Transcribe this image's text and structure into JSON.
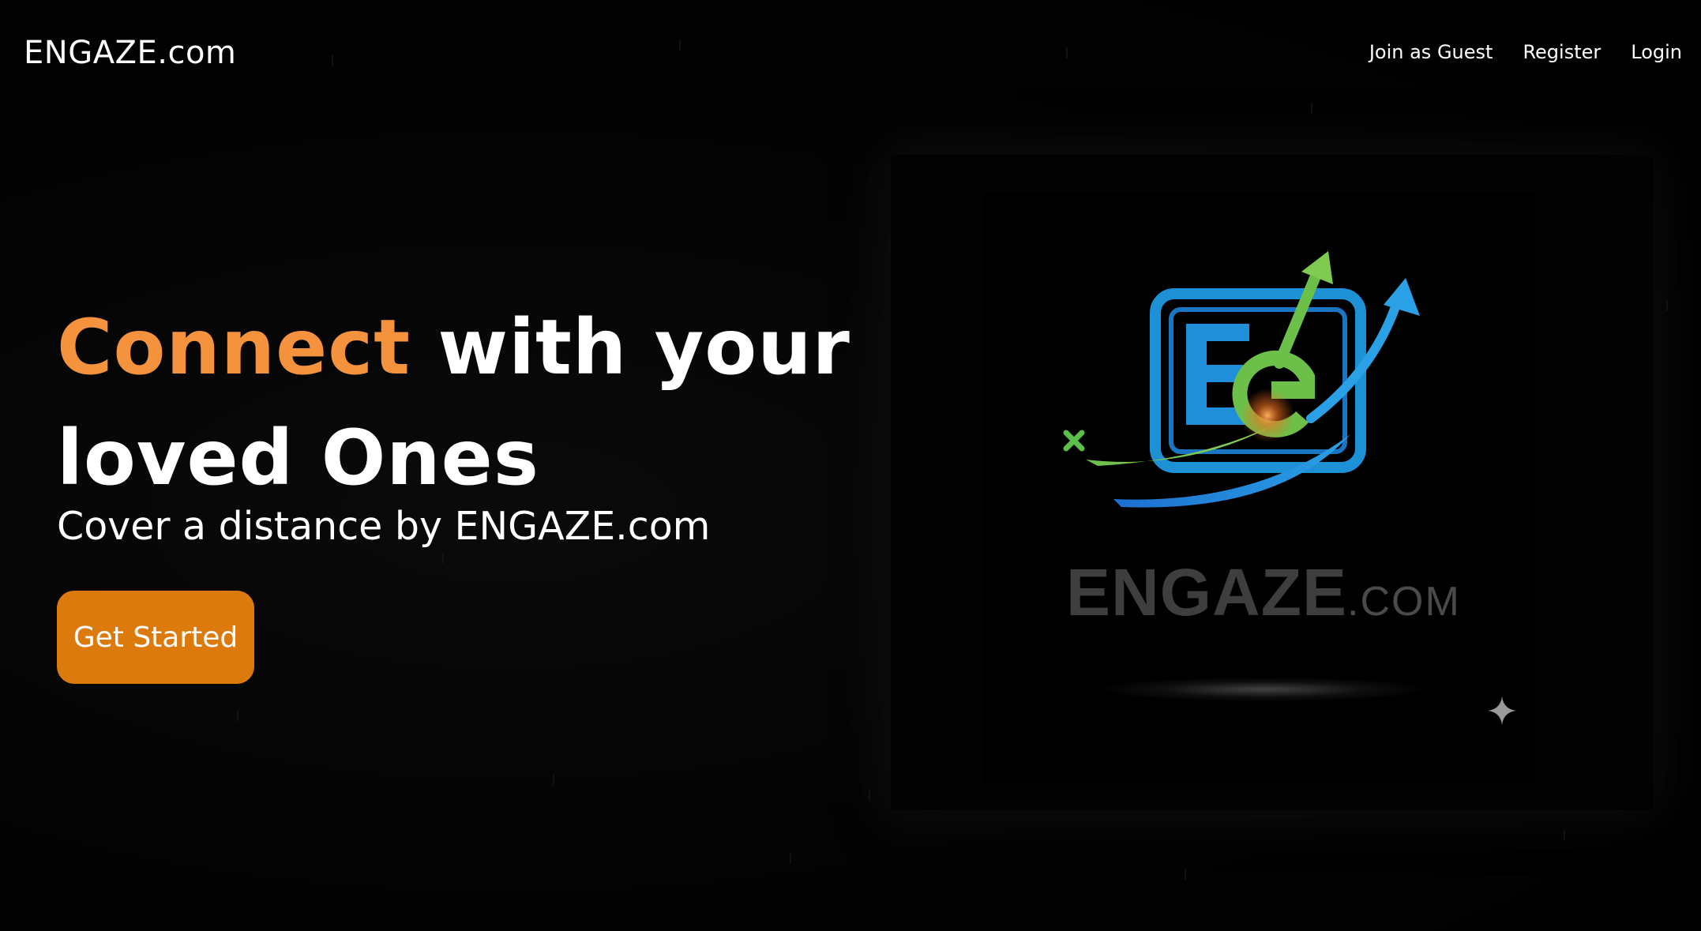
{
  "nav": {
    "brand": "ENGAZE.com",
    "links": [
      {
        "label": "Join as Guest"
      },
      {
        "label": "Register"
      },
      {
        "label": "Login"
      }
    ]
  },
  "hero": {
    "title_accent": "Connect",
    "title_rest": " with your loved Ones",
    "subtitle": "Cover a distance by ENGAZE.com",
    "cta_label": "Get Started"
  },
  "logo": {
    "monogram": "EG",
    "wordmark_main": "ENGAZE",
    "wordmark_suffix": ".COM"
  },
  "colors": {
    "background": "#000000",
    "accent_text": "#f5923e",
    "cta_background": "#dd7a0e",
    "logo_blue": "#1e90d6",
    "logo_green": "#6cc04a"
  }
}
